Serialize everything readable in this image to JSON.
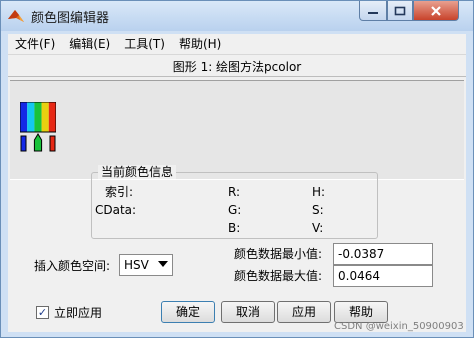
{
  "window": {
    "title": "颜色图编辑器"
  },
  "menu": {
    "items": [
      "文件(F)",
      "编辑(E)",
      "工具(T)",
      "帮助(H)"
    ]
  },
  "figure": {
    "label": "图形 1: 绘图方法pcolor"
  },
  "color_info": {
    "title": "当前颜色信息",
    "index_label": "索引:",
    "cdata_label": "CData:",
    "r_label": "R:",
    "g_label": "G:",
    "b_label": "B:",
    "h_label": "H:",
    "s_label": "S:",
    "v_label": "V:"
  },
  "interp": {
    "label": "插入颜色空间:",
    "value": "HSV"
  },
  "cdata_min": {
    "label": "颜色数据最小值:",
    "value": "-0.0387"
  },
  "cdata_max": {
    "label": "颜色数据最大值:",
    "value": "0.0464"
  },
  "apply_now": {
    "label": "立即应用",
    "checked": true,
    "check_glyph": "✓"
  },
  "buttons": {
    "ok": "确定",
    "cancel": "取消",
    "apply": "应用",
    "help": "帮助"
  },
  "watermark": "CSDN @weixin_50900903",
  "colors": {
    "marker_green": "#19c23a",
    "colorbar": [
      "#1428e6",
      "#14c8f0",
      "#19c23a",
      "#e8d010",
      "#e62814"
    ]
  }
}
